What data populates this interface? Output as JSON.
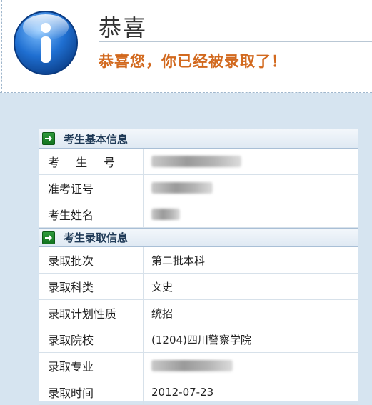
{
  "header": {
    "icon": "info-icon",
    "title": "恭喜",
    "message": "恭喜您，你已经被录取了！"
  },
  "sections": [
    {
      "icon": "arrow-right-icon",
      "title": "考生基本信息",
      "rows": [
        {
          "label": "考 生 号",
          "value": "",
          "redacted": true
        },
        {
          "label": "准考证号",
          "value": "",
          "redacted": true
        },
        {
          "label": "考生姓名",
          "value": "",
          "redacted": true
        }
      ]
    },
    {
      "icon": "arrow-right-icon",
      "title": "考生录取信息",
      "rows": [
        {
          "label": "录取批次",
          "value": "第二批本科"
        },
        {
          "label": "录取科类",
          "value": "文史"
        },
        {
          "label": "录取计划性质",
          "value": "统招"
        },
        {
          "label": "录取院校",
          "value": "(1204)四川警察学院"
        },
        {
          "label": "录取专业",
          "value": "",
          "redacted": true
        },
        {
          "label": "录取时间",
          "value": "2012-07-23"
        }
      ]
    }
  ],
  "colors": {
    "background": "#d6e4f0",
    "message": "#d2691e",
    "header_bg": "#dfe9f3",
    "icon_blue": "#1f6fd1",
    "arrow_green": "#1a8a2a"
  }
}
